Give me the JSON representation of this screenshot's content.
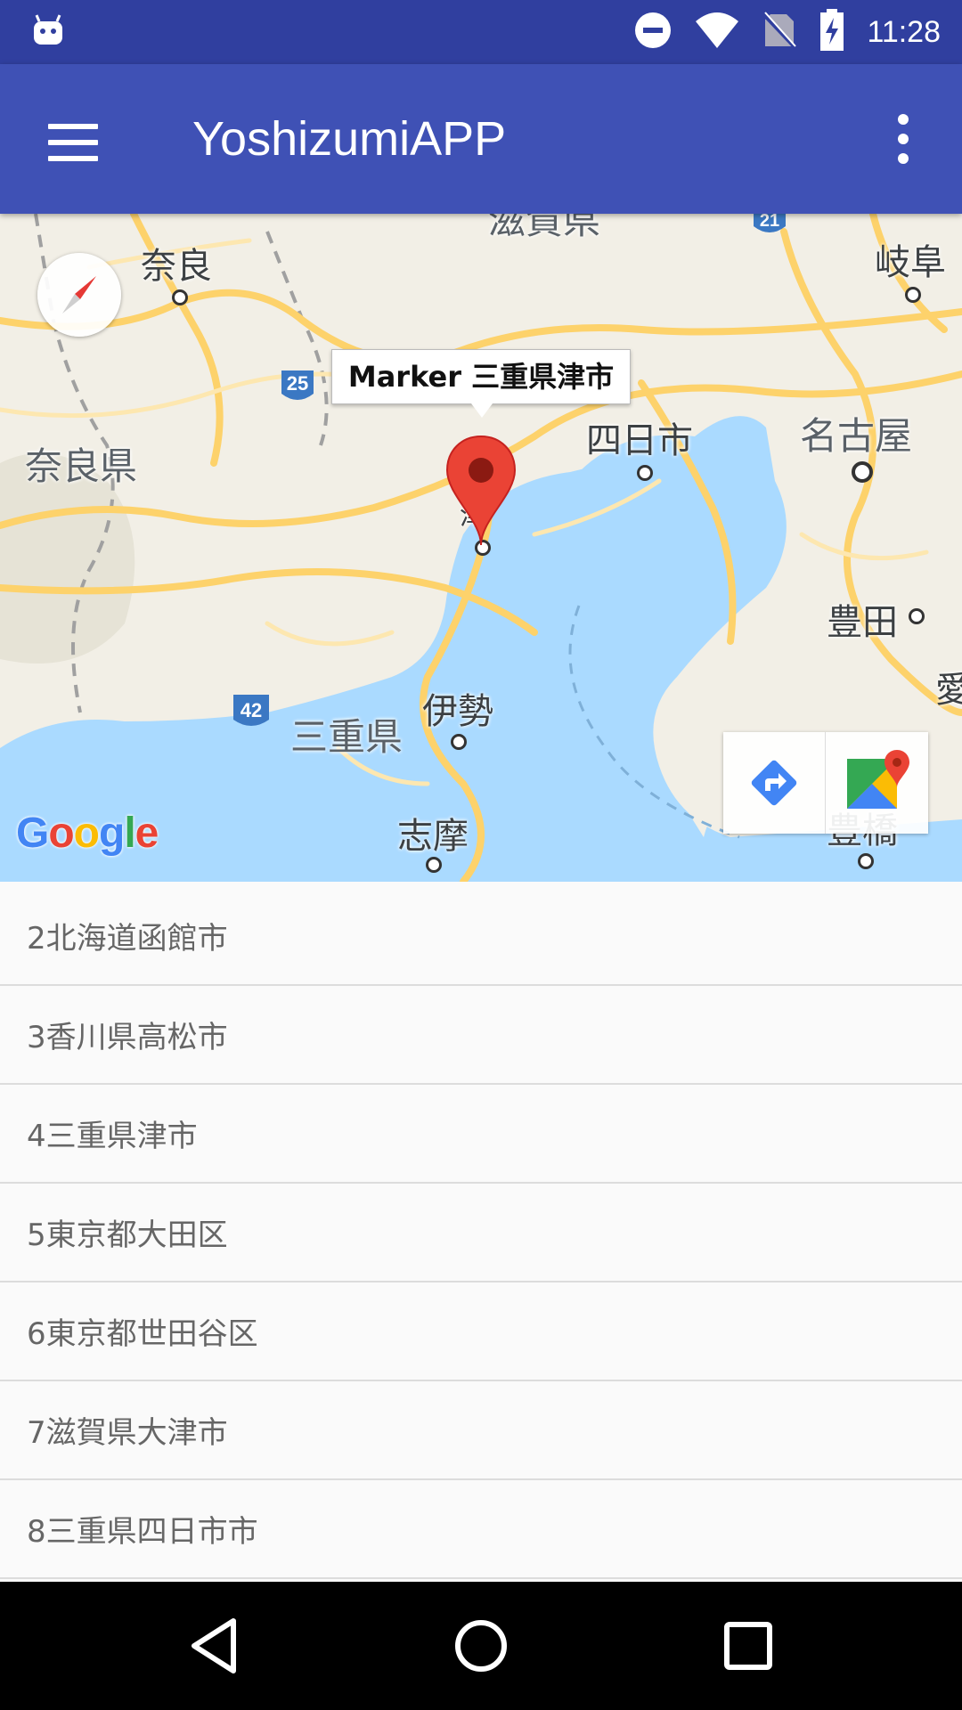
{
  "status_bar": {
    "time": "11:28",
    "icons": [
      "android-notification-icon",
      "do-not-disturb-icon",
      "wifi-icon",
      "no-sim-icon",
      "battery-charging-icon"
    ]
  },
  "app_bar": {
    "title": "YoshizumiAPP",
    "menu_icon": "hamburger-menu-icon",
    "overflow_icon": "more-vert-icon",
    "background": "#3f51b5",
    "status_background": "#303f9f"
  },
  "map": {
    "info_window": "Marker 三重県津市",
    "labels": {
      "nara": "奈良",
      "gifu": "岐阜",
      "nara_pref": "奈良県",
      "yokkaichi": "四日市",
      "nagoya": "名古屋",
      "toyota": "豊田",
      "ise": "伊勢",
      "mie_pref": "三重県",
      "shima": "志摩",
      "toyohashi": "豊橋",
      "ai": "愛",
      "shiga_pref": "滋賀県",
      "tsu": "津"
    },
    "route_shields": {
      "r25": "25",
      "r42": "42",
      "r21": "21"
    },
    "google_logo": {
      "g1": "G",
      "o1": "o",
      "o2": "o",
      "g2": "g",
      "l": "l",
      "e": "e"
    },
    "toolbar": [
      "directions-icon",
      "google-maps-icon"
    ],
    "water_color": "#aadaff",
    "road_color": "#fdd26b",
    "marker_color": "#ea4335"
  },
  "list": {
    "items": [
      "2北海道函館市",
      "3香川県高松市",
      "4三重県津市",
      "5東京都大田区",
      "6東京都世田谷区",
      "7滋賀県大津市",
      "8三重県四日市市"
    ]
  },
  "nav_bar": {
    "buttons": [
      "back-icon",
      "home-icon",
      "recents-icon"
    ]
  }
}
